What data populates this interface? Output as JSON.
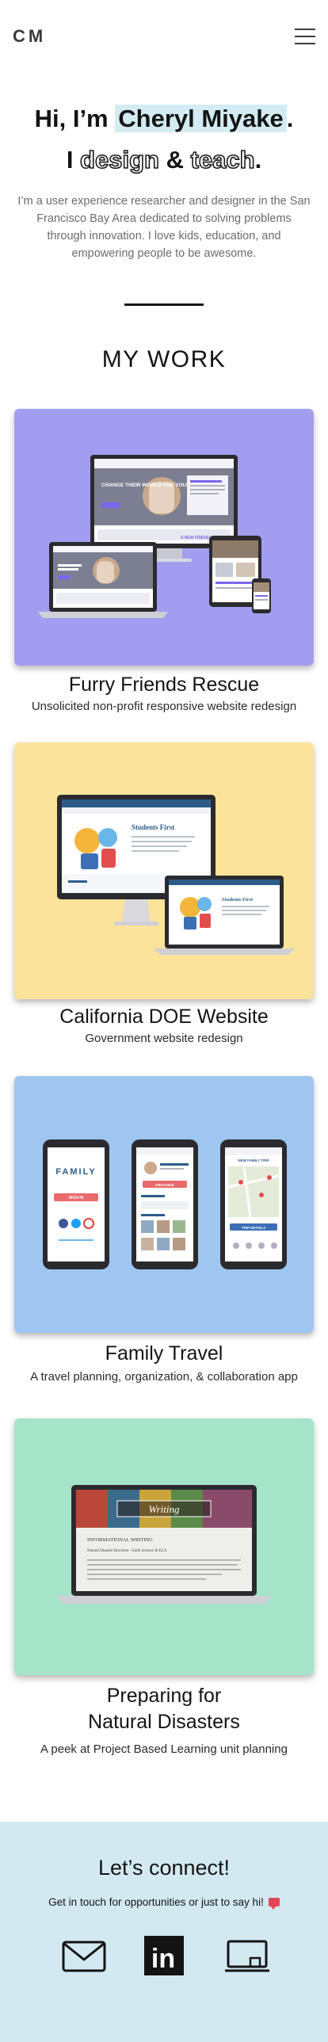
{
  "header": {
    "logo": "CM"
  },
  "hero": {
    "greeting": "Hi, I’m ",
    "name": "Cheryl Miyake",
    "period": ".",
    "role_prefix": "I ",
    "role_word1": "design",
    "role_amp": " & ",
    "role_word2": "teach",
    "role_period": ".",
    "intro": "I’m a user experience researcher and designer in the San Francisco Bay Area dedicated to solving problems through innovation. I love kids, education, and empowering people to be awesome."
  },
  "work": {
    "heading": "MY WORK"
  },
  "projects": [
    {
      "title": "Furry Friends Rescue",
      "subtitle": "Unsolicited non-profit responsive website redesign",
      "bg": "#a19ef0"
    },
    {
      "title": "California DOE Website",
      "subtitle": "Government website redesign",
      "bg": "#fbe39a"
    },
    {
      "title": "Family Travel",
      "subtitle": "A travel planning, organization, & collaboration app",
      "bg": "#9fc6f1"
    },
    {
      "title_line1": "Preparing for",
      "title_line2": "Natural Disasters",
      "subtitle": "A peek at Project Based Learning unit planning",
      "bg": "#a5e4c9"
    }
  ],
  "mockups": {
    "ffr_hero": "CHANGE THEIR WORLD AND YOURS",
    "ffr_cta": "ADOPT",
    "ffr_phone_line": "A NEW FRIEND",
    "doe_heading": "Students First",
    "family_logo": "FAMILY",
    "family_signin": "SIGN IN",
    "family_new": "ORGANIZE",
    "family_search": "NEW FAMILY TRIP",
    "family_map": "TRIP DETAILS",
    "writing_title": "Writing",
    "writing_heading": "INFORMATIONAL WRITING",
    "writing_sub": "Natural Disaster Brochure - Earth Science & ELA"
  },
  "contact": {
    "title": "Let’s connect!",
    "subtitle": "Get in touch for opportunities or just to say hi!",
    "linkedin": "in"
  },
  "colors": {
    "highlight": "#d3ecf3",
    "footer_bg": "#d3e9f1",
    "text": "#141414"
  }
}
